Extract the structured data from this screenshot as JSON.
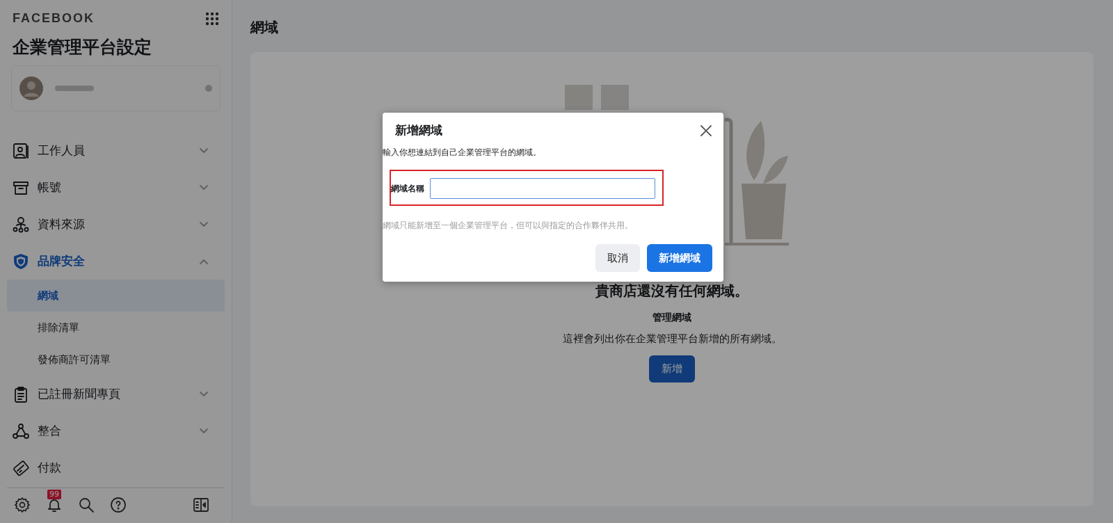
{
  "sidebar": {
    "brand": "FACEBOOK",
    "title": "企業管理平台設定",
    "nav": [
      {
        "label": "工作人員",
        "expandable": true,
        "expanded": false,
        "selected": false
      },
      {
        "label": "帳號",
        "expandable": true,
        "expanded": false,
        "selected": false
      },
      {
        "label": "資料來源",
        "expandable": true,
        "expanded": false,
        "selected": false
      },
      {
        "label": "品牌安全",
        "expandable": true,
        "expanded": true,
        "selected": true,
        "children": [
          {
            "label": "網域",
            "selected": true
          },
          {
            "label": "排除清單",
            "selected": false
          },
          {
            "label": "發佈商許可清單",
            "selected": false
          }
        ]
      },
      {
        "label": "已註冊新聞專頁",
        "expandable": true,
        "expanded": false,
        "selected": false
      },
      {
        "label": "整合",
        "expandable": true,
        "expanded": false,
        "selected": false
      },
      {
        "label": "付款",
        "expandable": false,
        "selected": false
      }
    ],
    "notification_badge": "99"
  },
  "main": {
    "title": "網域",
    "empty_state": {
      "heading": "貴商店還沒有任何網域。",
      "subheading": "管理網域",
      "text": "這裡會列出你在企業管理平台新增的所有網域。",
      "button": "新增"
    }
  },
  "dialog": {
    "title": "新增網域",
    "description": "輸入你想連結到自己企業管理平台的網域。",
    "field_label": "網域名稱",
    "hint": "網域只能新增至一個企業管理平台，但可以與指定的合作夥伴共用。",
    "buttons": [
      {
        "label": "取消",
        "kind": "secondary"
      },
      {
        "label": "新增網域",
        "kind": "primary"
      }
    ]
  }
}
